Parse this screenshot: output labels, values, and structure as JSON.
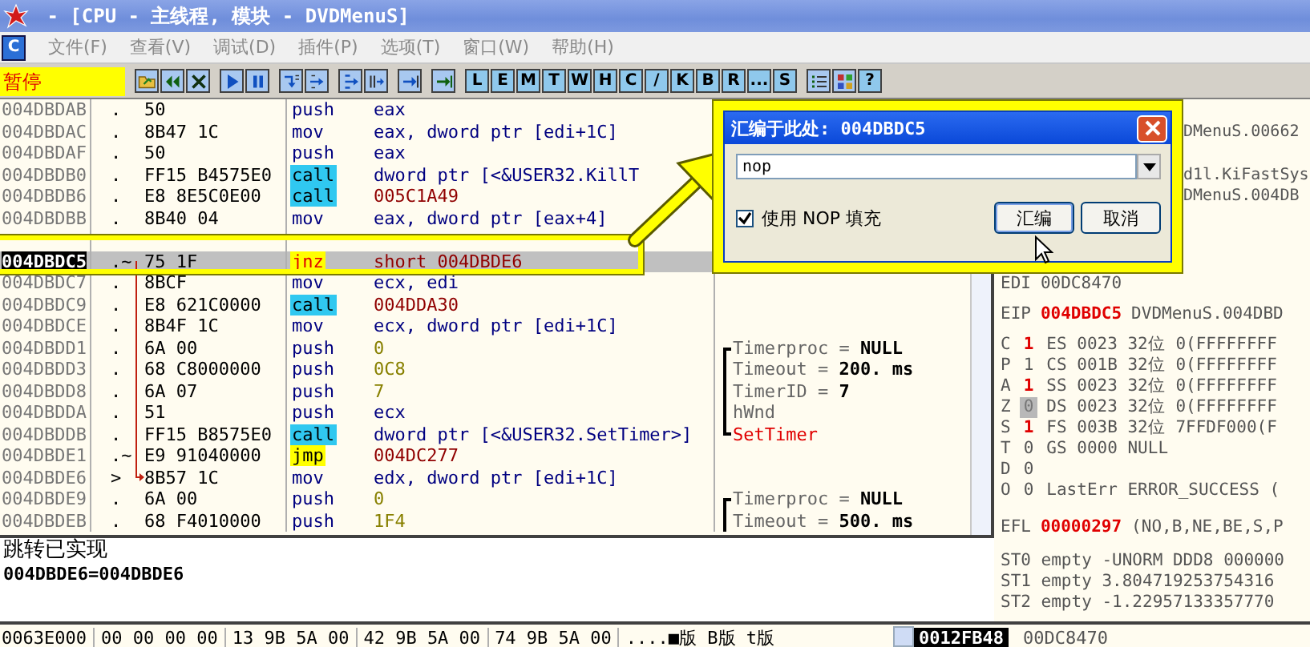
{
  "window": {
    "title": " - [CPU - 主线程, 模块 - DVDMenuS]"
  },
  "menu_bar": {
    "child_icon": "C",
    "items": [
      {
        "label": "文件(F)",
        "disabled": true
      },
      {
        "label": "查看(V)",
        "disabled": true
      },
      {
        "label": "调试(D)",
        "disabled": true
      },
      {
        "label": "插件(P)",
        "disabled": true
      },
      {
        "label": "选项(T)",
        "disabled": true
      },
      {
        "label": "窗口(W)",
        "disabled": true
      },
      {
        "label": "帮助(H)",
        "disabled": true
      }
    ]
  },
  "toolbar": {
    "status": "暂停",
    "groups": [
      [
        {
          "kind": "icon"
        },
        {
          "kind": "icon"
        },
        {
          "kind": "icon"
        }
      ],
      [
        {
          "kind": "icon"
        },
        {
          "kind": "icon"
        }
      ],
      [
        {
          "kind": "icon"
        },
        {
          "kind": "icon"
        }
      ],
      [
        {
          "kind": "icon"
        },
        {
          "kind": "icon"
        }
      ],
      [
        {
          "kind": "icon"
        }
      ],
      [
        {
          "kind": "icon"
        }
      ],
      [
        {
          "kind": "letter",
          "label": "L"
        },
        {
          "kind": "letter",
          "label": "E"
        },
        {
          "kind": "letter",
          "label": "M"
        },
        {
          "kind": "letter",
          "label": "T"
        },
        {
          "kind": "letter",
          "label": "W"
        },
        {
          "kind": "letter",
          "label": "H"
        },
        {
          "kind": "letter",
          "label": "C"
        },
        {
          "kind": "letter",
          "label": "/"
        },
        {
          "kind": "letter",
          "label": "K"
        },
        {
          "kind": "letter",
          "label": "B"
        },
        {
          "kind": "letter",
          "label": "R"
        },
        {
          "kind": "letter",
          "label": "..."
        },
        {
          "kind": "letter",
          "label": "S"
        }
      ],
      [
        {
          "kind": "icon"
        },
        {
          "kind": "icon"
        },
        {
          "kind": "letter",
          "label": "?"
        }
      ]
    ]
  },
  "disassembly": {
    "rows": [
      {
        "kind": "code",
        "address": "004DBDAB",
        "sign": ".",
        "bytes": "50",
        "mnemonic": {
          "text": "push",
          "kind": "plain"
        },
        "operand": {
          "text": "eax",
          "kind": "text"
        },
        "selected": false
      },
      {
        "kind": "code",
        "address": "004DBDAC",
        "sign": ".",
        "bytes": "8B47 1C",
        "mnemonic": {
          "text": "mov",
          "kind": "plain"
        },
        "operand": {
          "text": "eax, dword ptr [edi+1C]",
          "kind": "text"
        },
        "selected": false
      },
      {
        "kind": "code",
        "address": "004DBDAF",
        "sign": ".",
        "bytes": "50",
        "mnemonic": {
          "text": "push",
          "kind": "plain"
        },
        "operand": {
          "text": "eax",
          "kind": "text"
        },
        "selected": false
      },
      {
        "kind": "code",
        "address": "004DBDB0",
        "sign": ".",
        "bytes": "FF15 B4575E0",
        "mnemonic": {
          "text": "call",
          "kind": "call"
        },
        "operand": {
          "text": "dword ptr [<&USER32.KillT",
          "kind": "text"
        },
        "selected": false
      },
      {
        "kind": "code",
        "address": "004DBDB6",
        "sign": ".",
        "bytes": "E8 8E5C0E00",
        "mnemonic": {
          "text": "call",
          "kind": "call"
        },
        "operand": {
          "text": "005C1A49",
          "kind": "address"
        },
        "selected": false
      },
      {
        "kind": "code",
        "address": "004DBDBB",
        "sign": ".",
        "bytes": "8B40 04",
        "mnemonic": {
          "text": "mov",
          "kind": "plain"
        },
        "operand": {
          "text": "eax, dword ptr [eax+4]",
          "kind": "text"
        },
        "selected": false
      },
      {
        "kind": "covered",
        "selected": false
      },
      {
        "kind": "code",
        "address": "004DBDC5",
        "sign": ".~",
        "bytes": "75 1F",
        "mnemonic": {
          "text": "jnz",
          "kind": "cjump"
        },
        "operand": {
          "text": "short 004DBDE6",
          "kind": "address"
        },
        "selected": true,
        "jump": {
          "kind": "from"
        }
      },
      {
        "kind": "code",
        "address": "004DBDC7",
        "sign": ".",
        "bytes": "8BCF",
        "mnemonic": {
          "text": "mov",
          "kind": "plain"
        },
        "operand": {
          "text": "ecx, edi",
          "kind": "text"
        },
        "selected": false
      },
      {
        "kind": "code",
        "address": "004DBDC9",
        "sign": ".",
        "bytes": "E8 621C0000",
        "mnemonic": {
          "text": "call",
          "kind": "call"
        },
        "operand": {
          "text": "004DDA30",
          "kind": "address"
        },
        "selected": false
      },
      {
        "kind": "code",
        "address": "004DBDCE",
        "sign": ".",
        "bytes": "8B4F 1C",
        "mnemonic": {
          "text": "mov",
          "kind": "plain"
        },
        "operand": {
          "text": "ecx, dword ptr [edi+1C]",
          "kind": "text"
        },
        "selected": false
      },
      {
        "kind": "code",
        "address": "004DBDD1",
        "sign": ".",
        "bytes": "6A 00",
        "mnemonic": {
          "text": "push",
          "kind": "plain"
        },
        "operand": {
          "text": "0",
          "kind": "imm"
        },
        "selected": false,
        "comment": {
          "text": "Timerproc = **NULL**",
          "bracket": {
            "kind": "top"
          },
          "kind": "arg"
        }
      },
      {
        "kind": "code",
        "address": "004DBDD3",
        "sign": ".",
        "bytes": "68 C8000000",
        "mnemonic": {
          "text": "push",
          "kind": "plain"
        },
        "operand": {
          "text": "0C8",
          "kind": "imm"
        },
        "selected": false,
        "comment": {
          "text": "Timeout = **200. ms**",
          "bracket": {
            "kind": "mid"
          },
          "kind": "arg"
        }
      },
      {
        "kind": "code",
        "address": "004DBDD8",
        "sign": ".",
        "bytes": "6A 07",
        "mnemonic": {
          "text": "push",
          "kind": "plain"
        },
        "operand": {
          "text": "7",
          "kind": "imm"
        },
        "selected": false,
        "comment": {
          "text": "TimerID = **7**",
          "bracket": {
            "kind": "mid"
          },
          "kind": "arg"
        }
      },
      {
        "kind": "code",
        "address": "004DBDDA",
        "sign": ".",
        "bytes": "51",
        "mnemonic": {
          "text": "push",
          "kind": "plain"
        },
        "operand": {
          "text": "ecx",
          "kind": "text"
        },
        "selected": false,
        "comment": {
          "text": "hWnd",
          "bracket": {
            "kind": "mid"
          },
          "kind": "arg"
        }
      },
      {
        "kind": "code",
        "address": "004DBDDB",
        "sign": ".",
        "bytes": "FF15 B8575E0",
        "mnemonic": {
          "text": "call",
          "kind": "call"
        },
        "operand": {
          "text": "dword ptr [<&USER32.SetTimer>]",
          "kind": "text"
        },
        "selected": false,
        "comment": {
          "text": "SetTimer",
          "bracket": {
            "kind": "end"
          },
          "kind": "api"
        }
      },
      {
        "kind": "code",
        "address": "004DBDE1",
        "sign": ".~",
        "bytes": "E9 91040000",
        "mnemonic": {
          "text": "jmp",
          "kind": "jump"
        },
        "operand": {
          "text": "004DC277",
          "kind": "address"
        },
        "selected": false
      },
      {
        "kind": "code",
        "address": "004DBDE6",
        "sign": ">",
        "bytes": "8B57 1C",
        "mnemonic": {
          "text": "mov",
          "kind": "plain"
        },
        "operand": {
          "text": "edx, dword ptr [edi+1C]",
          "kind": "text"
        },
        "selected": false,
        "jump": {
          "kind": "to"
        }
      },
      {
        "kind": "code",
        "address": "004DBDE9",
        "sign": ".",
        "bytes": "6A 00",
        "mnemonic": {
          "text": "push",
          "kind": "plain"
        },
        "operand": {
          "text": "0",
          "kind": "imm"
        },
        "selected": false,
        "comment": {
          "text": "Timerproc = **NULL**",
          "bracket": {
            "kind": "top"
          },
          "kind": "arg"
        }
      },
      {
        "kind": "code",
        "address": "004DBDEB",
        "sign": ".",
        "bytes": "68 F4010000",
        "mnemonic": {
          "text": "push",
          "kind": "plain"
        },
        "operand": {
          "text": "1F4",
          "kind": "imm"
        },
        "selected": false,
        "comment": {
          "text": "Timeout = **500. ms**",
          "bracket": {
            "kind": "mid"
          },
          "kind": "arg"
        }
      }
    ]
  },
  "info": {
    "lines": [
      "跳转已实现",
      "004DBDE6=004DBDE6"
    ]
  },
  "registers": {
    "lines": [
      {
        "kind": "fragment",
        "text": "DMenuS.00662"
      },
      {
        "kind": "fragment",
        "text": "d1l.KiFastSys"
      },
      {
        "kind": "fragment",
        "text": "DMenuS.004DB"
      },
      {
        "kind": "reg",
        "name": "EDI",
        "value": "00DC8470",
        "changed": false
      },
      {
        "kind": "reg",
        "name": "EIP",
        "value": "004DBDC5",
        "changed": true,
        "note": "DVDMenuS.004DBD"
      },
      {
        "kind": "flag",
        "name": "C",
        "value": "1",
        "changed": true,
        "selected": false,
        "seg": "ES 0023 32位 0(FFFFFFFF"
      },
      {
        "kind": "flag",
        "name": "P",
        "value": "1",
        "changed": false,
        "selected": false,
        "seg": "CS 001B 32位 0(FFFFFFFF"
      },
      {
        "kind": "flag",
        "name": "A",
        "value": "1",
        "changed": true,
        "selected": false,
        "seg": "SS 0023 32位 0(FFFFFFFF"
      },
      {
        "kind": "flag",
        "name": "Z",
        "value": "0",
        "changed": false,
        "selected": true,
        "seg": "DS 0023 32位 0(FFFFFFFF"
      },
      {
        "kind": "flag",
        "name": "S",
        "value": "1",
        "changed": true,
        "selected": false,
        "seg": "FS 003B 32位 7FFDF000(F"
      },
      {
        "kind": "flag",
        "name": "T",
        "value": "0",
        "changed": false,
        "selected": false,
        "seg": "GS 0000 NULL"
      },
      {
        "kind": "flag",
        "name": "D",
        "value": "0",
        "changed": false,
        "selected": false
      },
      {
        "kind": "flag",
        "name": "O",
        "value": "0",
        "changed": false,
        "selected": false,
        "seg": "LastErr ERROR_SUCCESS ("
      },
      {
        "kind": "reg",
        "name": "EFL",
        "value": "00000297",
        "changed": true,
        "note": "(NO,B,NE,BE,S,P"
      },
      {
        "kind": "fpu",
        "text": "ST0 empty -UNORM DDD8 000000"
      },
      {
        "kind": "fpu",
        "text": "ST1 empty 3.804719253754316"
      },
      {
        "kind": "fpu",
        "text": "ST2 empty -1.22957133357770"
      }
    ]
  },
  "dump": {
    "address": "0063E000",
    "cells": [
      "00 00 00 00",
      "13 9B 5A 00",
      "42 9B 5A 00",
      "74 9B 5A 00"
    ],
    "ascii": "....■版 B版 t版"
  },
  "stack": {
    "items": [
      {
        "value": "0012FB48",
        "selected": true
      },
      {
        "value": "00DC8470",
        "selected": false
      }
    ]
  },
  "dialog": {
    "title": "汇编于此处: 004DBDC5",
    "value": "nop",
    "checkbox": {
      "label": "使用 NOP 填充",
      "checked": true
    },
    "buttons": [
      {
        "label": "汇编",
        "focused": true
      },
      {
        "label": "取消",
        "focused": false
      }
    ]
  }
}
